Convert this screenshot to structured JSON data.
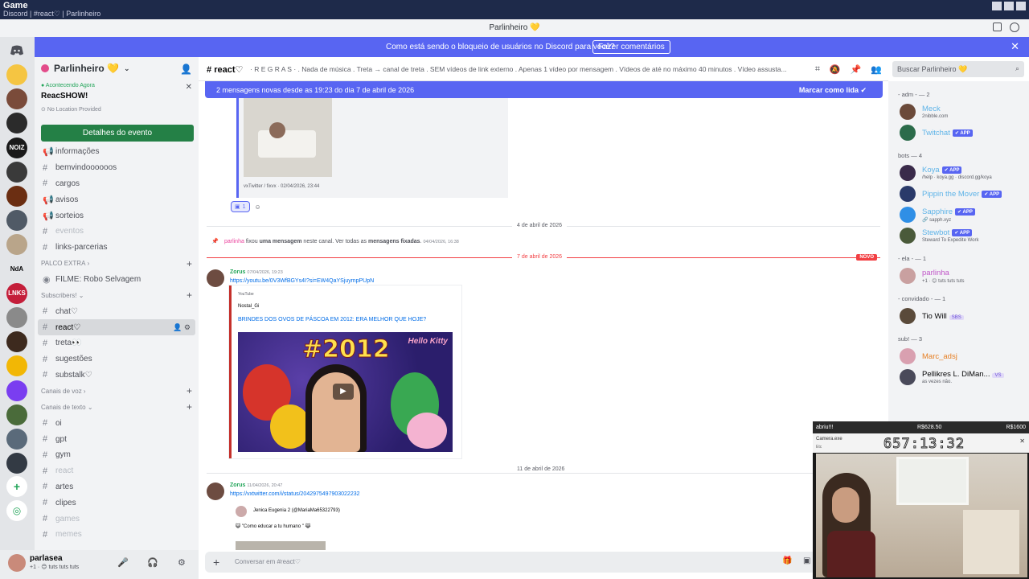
{
  "os": {
    "title": "Game",
    "subtitle": "Discord | #react♡ | Parlinheiro"
  },
  "topbar": {
    "server_title": "Parlinheiro 💛"
  },
  "banner": {
    "message": "Como está sendo o bloqueio de usuários no Discord para você?",
    "button": "Fazer comentários",
    "close": "✕"
  },
  "server_rail": {
    "items": [
      {
        "label": "",
        "color": "#f5c542"
      },
      {
        "label": "",
        "color": "#7a4b3a"
      },
      {
        "label": "",
        "color": "#2b2b2b"
      },
      {
        "label": "NOIZ",
        "color": "#1a1a1a"
      },
      {
        "label": "",
        "color": "#3a3a3a"
      },
      {
        "label": "",
        "color": "#6b2e12"
      },
      {
        "label": "",
        "color": "#505a66"
      },
      {
        "label": "",
        "color": "#b9a58a"
      },
      {
        "label": "NdA",
        "color": "#e3e5e8"
      },
      {
        "label": "LNKS",
        "color": "#c41e3a"
      },
      {
        "label": "",
        "color": "#8a8a8a"
      },
      {
        "label": "",
        "color": "#3d2a1e"
      },
      {
        "label": "",
        "color": "#f2b705"
      },
      {
        "label": "",
        "color": "#7a3ef0"
      },
      {
        "label": "",
        "color": "#4a6b3a"
      },
      {
        "label": "",
        "color": "#5a6a7a"
      },
      {
        "label": "",
        "color": "#333a44"
      }
    ]
  },
  "sidebar": {
    "server_name": "Parlinheiro 💛",
    "event": {
      "live_label": "Acontecendo Agora",
      "title": "ReacSHOW!",
      "location": "No Location Provided",
      "button": "Detalhes do evento"
    },
    "channels_top": [
      {
        "icon": "📢",
        "name": "informações",
        "muted": false
      },
      {
        "icon": "#",
        "name": "bemvindoooooos",
        "muted": false
      },
      {
        "icon": "#",
        "name": "cargos",
        "muted": false
      },
      {
        "icon": "📢",
        "name": "avisos",
        "muted": false
      },
      {
        "icon": "📢",
        "name": "sorteios",
        "muted": false
      },
      {
        "icon": "#",
        "name": "eventos",
        "muted": true
      },
      {
        "icon": "#",
        "name": "links-parcerias",
        "muted": false
      }
    ],
    "category_palco": "PALCO EXTRA",
    "stage_channel": "FILME: Robo Selvagem",
    "category_subscribers": "Subscribers!",
    "channels_sub": [
      {
        "icon": "#",
        "name": "chat♡",
        "selected": false
      },
      {
        "icon": "#",
        "name": "react♡",
        "selected": true
      },
      {
        "icon": "#",
        "name": "treta👀",
        "selected": false
      },
      {
        "icon": "#",
        "name": "sugestões",
        "selected": false
      },
      {
        "icon": "#",
        "name": "substalk♡",
        "selected": false
      }
    ],
    "category_voice": "Canais de voz",
    "category_text": "Canais de texto",
    "channels_text": [
      {
        "icon": "#",
        "name": "oi",
        "muted": false
      },
      {
        "icon": "#",
        "name": "gpt",
        "muted": false
      },
      {
        "icon": "#",
        "name": "gym",
        "muted": false
      },
      {
        "icon": "#",
        "name": "react",
        "muted": true
      },
      {
        "icon": "#",
        "name": "artes",
        "muted": false
      },
      {
        "icon": "#",
        "name": "clipes",
        "muted": false
      },
      {
        "icon": "#",
        "name": "games",
        "muted": true
      },
      {
        "icon": "#",
        "name": "memes",
        "muted": true
      }
    ]
  },
  "userpanel": {
    "name": "parlasea",
    "status": "+1 · 😊 tuts tuts tuts"
  },
  "chat": {
    "channel_name": "react♡",
    "topic": "· R E G R A S · . Nada de música . Treta → canal de treta . SEM vídeos de link externo . Apenas 1 vídeo por mensagem . Vídeos de até no máximo 40 minutos . Vídeo assusta...",
    "search_placeholder": "Buscar Parlinheiro 💛",
    "newbar_left": "2 mensagens novas desde as 19:23 do dia 7 de abril de 2026",
    "newbar_right": "Marcar como lida",
    "embed_top_footer": "vxTwitter / fixvx · 02/04/2026, 23:44",
    "reaction_count": "1",
    "date1": "4 de abril de 2026",
    "pin_user": "parlinha",
    "pin_text_1": " fixou ",
    "pin_text_bold1": "uma mensagem",
    "pin_text_2": " neste canal. Ver todas as ",
    "pin_text_bold2": "mensagens fixadas",
    "pin_text_3": ".",
    "pin_time": "04/04/2026, 16:38",
    "date2": "7 de abril de 2026",
    "novo": "NOVO",
    "msg1": {
      "author": "Zorus",
      "time": "07/04/2026, 19:23",
      "link": "https://youtu.be/0V3WfBGYs4I?si=EW4QaYSjuympPUpN",
      "provider": "YouTube",
      "channel": "Nostal_Gi",
      "title": "BRINDES DOS OVOS DE PÁSCOA EM 2012: ERA MELHOR QUE HOJE?",
      "thumb_year": "#2012",
      "thumb_brand": "Hello Kitty"
    },
    "date3": "11 de abril de 2026",
    "msg2": {
      "author": "Zorus",
      "time": "11/04/2026, 20:47",
      "link": "https://vxtwitter.com/i/status/2042975497903022232",
      "tweet_author": "Jenica Eugenia 2 (@MariaMa65322793)",
      "tweet_text": "😺 \"Como educar a tu humano \" 😹"
    },
    "composer_placeholder": "Conversar em #react♡"
  },
  "members": {
    "groups": [
      {
        "label": "- adm - — 2",
        "members": [
          {
            "name": "Meck",
            "sub": "2nibble.com",
            "color": "#5fb4e8",
            "app": false,
            "tag": ""
          },
          {
            "name": "Twitchat",
            "sub": "",
            "color": "#5fb4e8",
            "app": true,
            "tag": ""
          }
        ]
      },
      {
        "label": "bots — 4",
        "members": [
          {
            "name": "Koya",
            "sub": "/help · koya.gg · discord.gg/koya",
            "color": "#5fb4e8",
            "app": true,
            "tag": ""
          },
          {
            "name": "Pippin the Mover",
            "sub": "",
            "color": "#5fb4e8",
            "app": true,
            "tag": ""
          },
          {
            "name": "Sapphire",
            "sub": "🔗 sapph.xyz",
            "color": "#5fb4e8",
            "app": true,
            "tag": ""
          },
          {
            "name": "Stewbot",
            "sub": "Steward To Expedite Work",
            "color": "#5fb4e8",
            "app": true,
            "tag": ""
          }
        ]
      },
      {
        "label": "- ela - — 1",
        "members": [
          {
            "name": "parlinha",
            "sub": "+1 · 😊 tuts tuts tuts",
            "color": "#c055c8",
            "app": false,
            "tag": ""
          }
        ]
      },
      {
        "label": "- convidado - — 1",
        "members": [
          {
            "name": "Tio Will",
            "sub": "",
            "color": "#060607",
            "app": false,
            "tag": "SBS"
          }
        ]
      },
      {
        "label": "sub! — 3",
        "members": [
          {
            "name": "Marc_adsj",
            "sub": "",
            "color": "#e67e22",
            "app": false,
            "tag": ""
          },
          {
            "name": "Pellikres L. DiMan...",
            "sub": "as vezes não.",
            "color": "#060607",
            "app": false,
            "tag": "VS"
          }
        ]
      }
    ]
  },
  "overlay": {
    "left_label": "abriu!!!",
    "mid_value": "R$628.50",
    "right_value": "R$1600",
    "window_title": "Camera.exe",
    "window_sub": "Etc",
    "timer": "657:13:32"
  }
}
